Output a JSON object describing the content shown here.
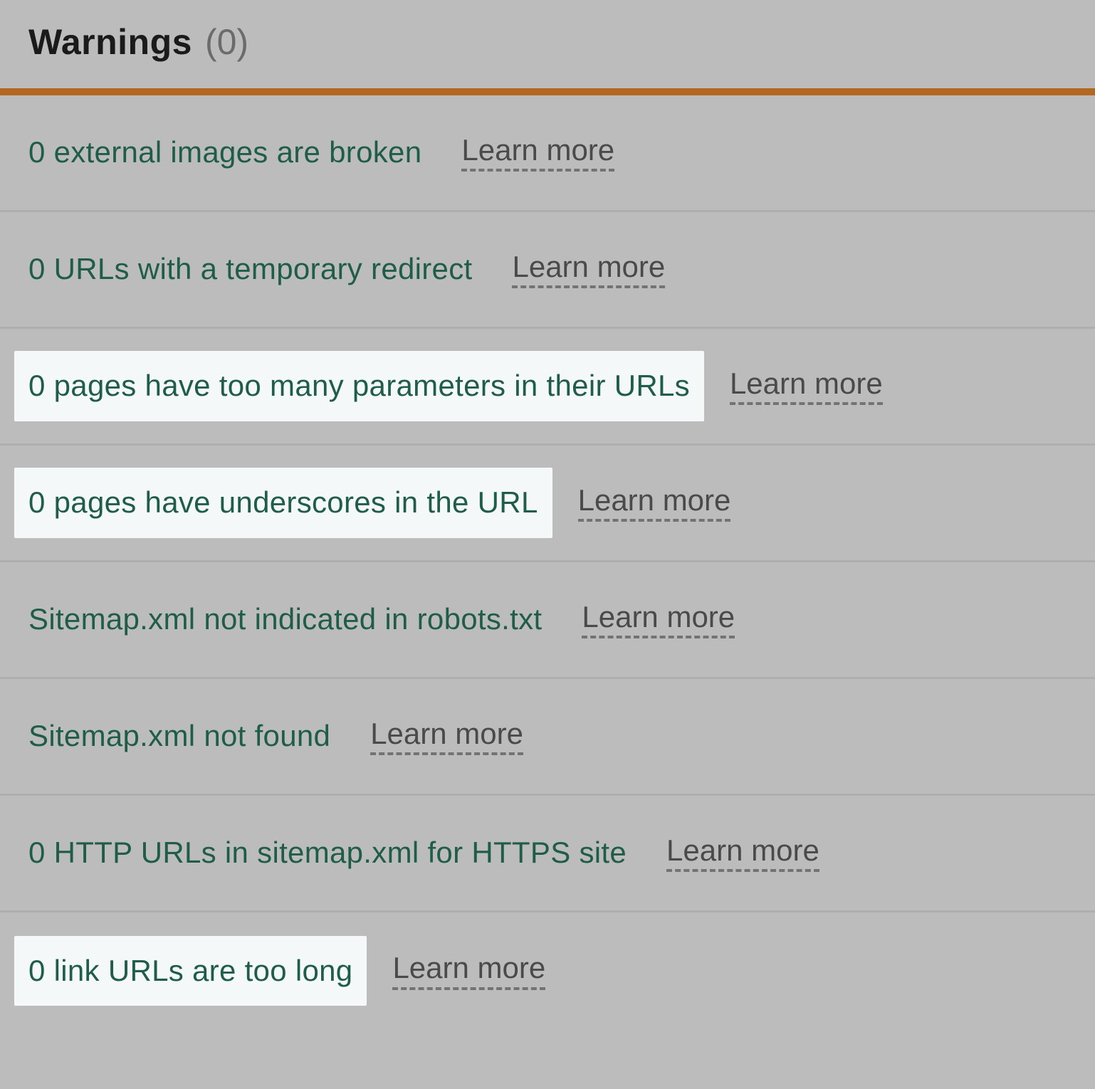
{
  "header": {
    "title": "Warnings",
    "count": "(0)"
  },
  "learn_more_label": "Learn more",
  "warnings": [
    {
      "text": "0 external images are broken",
      "highlighted": false
    },
    {
      "text": "0 URLs with a temporary redirect",
      "highlighted": false
    },
    {
      "text": "0 pages have too many parameters in their URLs",
      "highlighted": true
    },
    {
      "text": "0 pages have underscores in the URL",
      "highlighted": true
    },
    {
      "text": "Sitemap.xml not indicated in robots.txt",
      "highlighted": false
    },
    {
      "text": "Sitemap.xml not found",
      "highlighted": false
    },
    {
      "text": "0 HTTP URLs in sitemap.xml for HTTPS site",
      "highlighted": false
    },
    {
      "text": "0 link URLs are too long",
      "highlighted": true
    }
  ]
}
